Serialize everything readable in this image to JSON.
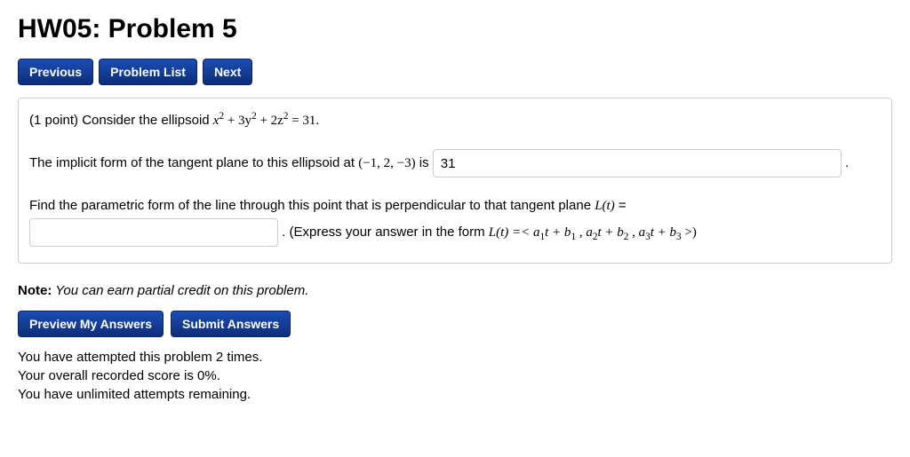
{
  "title": "HW05: Problem 5",
  "nav": {
    "previous": "Previous",
    "problemList": "Problem List",
    "next": "Next"
  },
  "problem": {
    "points_prefix": "(1 point) ",
    "intro1": "Consider the ellipsoid ",
    "eq1_a": "x",
    "eq1_b": " + 3y",
    "eq1_c": " + 2z",
    "eq1_d": " = 31.",
    "line2a": "The implicit form of the tangent plane to this ellipsoid at ",
    "point": "(−1, 2, −3)",
    "line2b": " is ",
    "answer1_value": "31",
    "line2c": " .",
    "line3a": "Find the parametric form of the line through this point that is perpendicular to that tangent plane ",
    "Lt": "L(t)",
    "eqsym": " = ",
    "answer2_value": "",
    "line4a": " . (Express your answer in the form ",
    "form1": "L(t) =< a",
    "form2": "t + b",
    "form3": " , a",
    "form4": "t + b",
    "form5": " , a",
    "form6": "t + b",
    "form7": " >)"
  },
  "note": {
    "label": "Note:",
    "text": " You can earn partial credit on this problem."
  },
  "buttons": {
    "preview": "Preview My Answers",
    "submit": "Submit Answers"
  },
  "status": {
    "attempts": "You have attempted this problem 2 times.",
    "score": "Your overall recorded score is 0%.",
    "remaining": "You have unlimited attempts remaining."
  }
}
